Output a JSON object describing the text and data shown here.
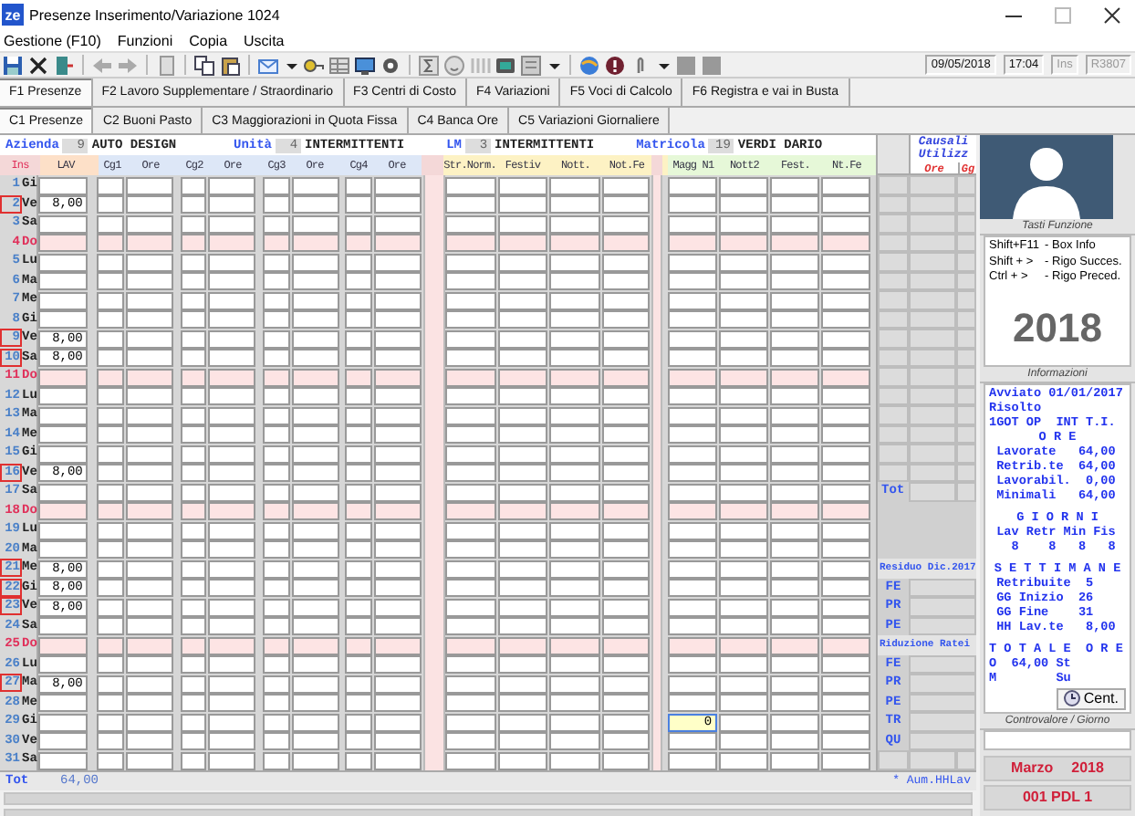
{
  "window": {
    "icon_text": "ze",
    "title": "Presenze Inserimento/Variazione 1024"
  },
  "menu": [
    "Gestione (F10)",
    "Funzioni",
    "Copia",
    "Uscita"
  ],
  "status_fields": [
    {
      "text": "09/05/2018",
      "disabled": false
    },
    {
      "text": "17:04",
      "disabled": false
    },
    {
      "text": "Ins",
      "disabled": true
    },
    {
      "text": "R3807",
      "disabled": true
    }
  ],
  "tabs": [
    {
      "label": "F1 Presenze",
      "selected": true
    },
    {
      "label": "F2 Lavoro Supplementare / Straordinario",
      "selected": false
    },
    {
      "label": "F3 Centri di Costo",
      "selected": false
    },
    {
      "label": "F4 Variazioni",
      "selected": false
    },
    {
      "label": "F5 Voci di Calcolo",
      "selected": false
    },
    {
      "label": "F6 Registra e vai in Busta",
      "selected": false
    }
  ],
  "subtabs": [
    {
      "label": "C1 Presenze",
      "selected": true
    },
    {
      "label": "C2 Buoni Pasto",
      "selected": false
    },
    {
      "label": "C3 Maggiorazioni in Quota Fissa",
      "selected": false
    },
    {
      "label": "C4 Banca Ore",
      "selected": false
    },
    {
      "label": "C5 Variazioni Giornaliere",
      "selected": false
    }
  ],
  "header_info": [
    {
      "kind": "label",
      "text": "Azienda"
    },
    {
      "kind": "code",
      "text": "9"
    },
    {
      "kind": "value",
      "text": "AUTO DESIGN"
    },
    {
      "kind": "label",
      "text": "Unità"
    },
    {
      "kind": "code",
      "text": "4"
    },
    {
      "kind": "value",
      "text": "INTERMITTENTI"
    },
    {
      "kind": "label",
      "text": "LM"
    },
    {
      "kind": "code",
      "text": "3"
    },
    {
      "kind": "value",
      "text": "INTERMITTENTI"
    },
    {
      "kind": "label",
      "text": "Matricola"
    },
    {
      "kind": "code",
      "text": "19"
    },
    {
      "kind": "value",
      "text": "VERDI DARIO"
    }
  ],
  "columns": [
    "Ins",
    "LAV",
    "Cg1",
    "Ore",
    "Cg2",
    "Ore",
    "Cg3",
    "Ore",
    "Cg4",
    "Ore",
    "Str.Norm.",
    "Festiv",
    "Nott.",
    "Not.Fe",
    "Magg N1",
    "Nott2",
    "Fest.",
    "Nt.Fe"
  ],
  "days": [
    {
      "num": "1",
      "weekday": "Gi",
      "holiday": false,
      "flagged": false,
      "focused": false
    },
    {
      "num": "2",
      "weekday": "Ve",
      "holiday": false,
      "flagged": true,
      "focused": false,
      "lav": "8,00"
    },
    {
      "num": "3",
      "weekday": "Sa",
      "holiday": false,
      "flagged": false,
      "focused": false
    },
    {
      "num": "4",
      "weekday": "Do",
      "holiday": true,
      "flagged": false,
      "focused": false
    },
    {
      "num": "5",
      "weekday": "Lu",
      "holiday": false,
      "flagged": false,
      "focused": false
    },
    {
      "num": "6",
      "weekday": "Ma",
      "holiday": false,
      "flagged": false,
      "focused": false
    },
    {
      "num": "7",
      "weekday": "Me",
      "holiday": false,
      "flagged": false,
      "focused": false
    },
    {
      "num": "8",
      "weekday": "Gi",
      "holiday": false,
      "flagged": false,
      "focused": false
    },
    {
      "num": "9",
      "weekday": "Ve",
      "holiday": false,
      "flagged": true,
      "focused": false,
      "lav": "8,00"
    },
    {
      "num": "10",
      "weekday": "Sa",
      "holiday": false,
      "flagged": true,
      "focused": false,
      "lav": "8,00"
    },
    {
      "num": "11",
      "weekday": "Do",
      "holiday": true,
      "flagged": false,
      "focused": false
    },
    {
      "num": "12",
      "weekday": "Lu",
      "holiday": false,
      "flagged": false,
      "focused": false
    },
    {
      "num": "13",
      "weekday": "Ma",
      "holiday": false,
      "flagged": false,
      "focused": false
    },
    {
      "num": "14",
      "weekday": "Me",
      "holiday": false,
      "flagged": false,
      "focused": false
    },
    {
      "num": "15",
      "weekday": "Gi",
      "holiday": false,
      "flagged": false,
      "focused": false
    },
    {
      "num": "16",
      "weekday": "Ve",
      "holiday": false,
      "flagged": true,
      "focused": false,
      "lav": "8,00"
    },
    {
      "num": "17",
      "weekday": "Sa",
      "holiday": false,
      "flagged": false,
      "focused": false
    },
    {
      "num": "18",
      "weekday": "Do",
      "holiday": true,
      "flagged": false,
      "focused": false
    },
    {
      "num": "19",
      "weekday": "Lu",
      "holiday": false,
      "flagged": false,
      "focused": false
    },
    {
      "num": "20",
      "weekday": "Ma",
      "holiday": false,
      "flagged": false,
      "focused": false
    },
    {
      "num": "21",
      "weekday": "Me",
      "holiday": false,
      "flagged": true,
      "focused": false,
      "lav": "8,00"
    },
    {
      "num": "22",
      "weekday": "Gi",
      "holiday": false,
      "flagged": true,
      "focused": false,
      "lav": "8,00"
    },
    {
      "num": "23",
      "weekday": "Ve",
      "holiday": false,
      "flagged": true,
      "focused": false,
      "lav": "8,00"
    },
    {
      "num": "24",
      "weekday": "Sa",
      "holiday": false,
      "flagged": false,
      "focused": false
    },
    {
      "num": "25",
      "weekday": "Do",
      "holiday": true,
      "flagged": false,
      "focused": false
    },
    {
      "num": "26",
      "weekday": "Lu",
      "holiday": false,
      "flagged": false,
      "focused": false
    },
    {
      "num": "27",
      "weekday": "Ma",
      "holiday": false,
      "flagged": true,
      "focused": false,
      "lav": "8,00"
    },
    {
      "num": "28",
      "weekday": "Me",
      "holiday": false,
      "flagged": false,
      "focused": false
    },
    {
      "num": "29",
      "weekday": "Gi",
      "holiday": false,
      "flagged": false,
      "focused": true,
      "magg_n1": "0"
    },
    {
      "num": "30",
      "weekday": "Ve",
      "holiday": false,
      "flagged": false,
      "focused": false
    },
    {
      "num": "31",
      "weekday": "Sa",
      "holiday": false,
      "flagged": false,
      "focused": false
    }
  ],
  "totals": {
    "label": "Tot",
    "lav": "64,00",
    "note": "* Aum.HHLav"
  },
  "causali": {
    "title": [
      "Causali",
      "Utilizz"
    ],
    "columns": [
      "Ore",
      "Gg"
    ],
    "rows": [
      {
        "kind": "tot",
        "label": "Tot"
      },
      {
        "kind": "heading",
        "label": "Residuo Dic.2017"
      },
      {
        "kind": "code",
        "label": "FE"
      },
      {
        "kind": "code",
        "label": "PR"
      },
      {
        "kind": "code",
        "label": "PE"
      },
      {
        "kind": "heading",
        "label": "Riduzione Ratei"
      },
      {
        "kind": "code",
        "label": "FE"
      },
      {
        "kind": "code",
        "label": "PR"
      },
      {
        "kind": "code",
        "label": "PE"
      },
      {
        "kind": "code",
        "label": "TR"
      },
      {
        "kind": "code",
        "label": "QU"
      }
    ]
  },
  "side": {
    "shortcuts_title": "Tasti Funzione",
    "shortcuts": [
      {
        "keys": "Shift+F11",
        "action": "- Box Info"
      },
      {
        "keys": "Shift + >",
        "action": "- Rigo Succes."
      },
      {
        "keys": "Ctrl + >",
        "action": "- Rigo Preced."
      }
    ],
    "year": "2018",
    "info_title": "Informazioni",
    "info_lines": [
      {
        "kind": "text",
        "text": "Avviato 01/01/2017"
      },
      {
        "kind": "text",
        "text": "Risolto"
      },
      {
        "kind": "text",
        "text": "1GOT OP  INT T.I."
      },
      {
        "kind": "heading",
        "text": "O R E"
      },
      {
        "kind": "text",
        "text": " Lavorate   64,00"
      },
      {
        "kind": "text",
        "text": " Retrib.te  64,00"
      },
      {
        "kind": "text",
        "text": " Lavorabil.  0,00"
      },
      {
        "kind": "text",
        "text": " Minimali   64,00"
      },
      {
        "kind": "blank"
      },
      {
        "kind": "heading",
        "text": "G I O R N I"
      },
      {
        "kind": "text",
        "text": " Lav Retr Min Fis"
      },
      {
        "kind": "text",
        "text": "   8    8   8   8"
      },
      {
        "kind": "blank"
      },
      {
        "kind": "heading",
        "text": "S E T T I M A N E"
      },
      {
        "kind": "text",
        "text": " Retribuite  5"
      },
      {
        "kind": "text",
        "text": " GG Inizio  26"
      },
      {
        "kind": "text",
        "text": " GG Fine    31"
      },
      {
        "kind": "text",
        "text": " HH Lav.te   8,00"
      },
      {
        "kind": "blank"
      },
      {
        "kind": "text",
        "text": "T O T A L E  O R E"
      },
      {
        "kind": "text",
        "text": "O  64,00 St"
      },
      {
        "kind": "text",
        "text": "M        Su"
      }
    ],
    "cent_button": "Cent.",
    "value_title": "Controvalore / Giorno",
    "month": "Marzo",
    "month_year": "2018",
    "payroll": "001 PDL 1"
  }
}
